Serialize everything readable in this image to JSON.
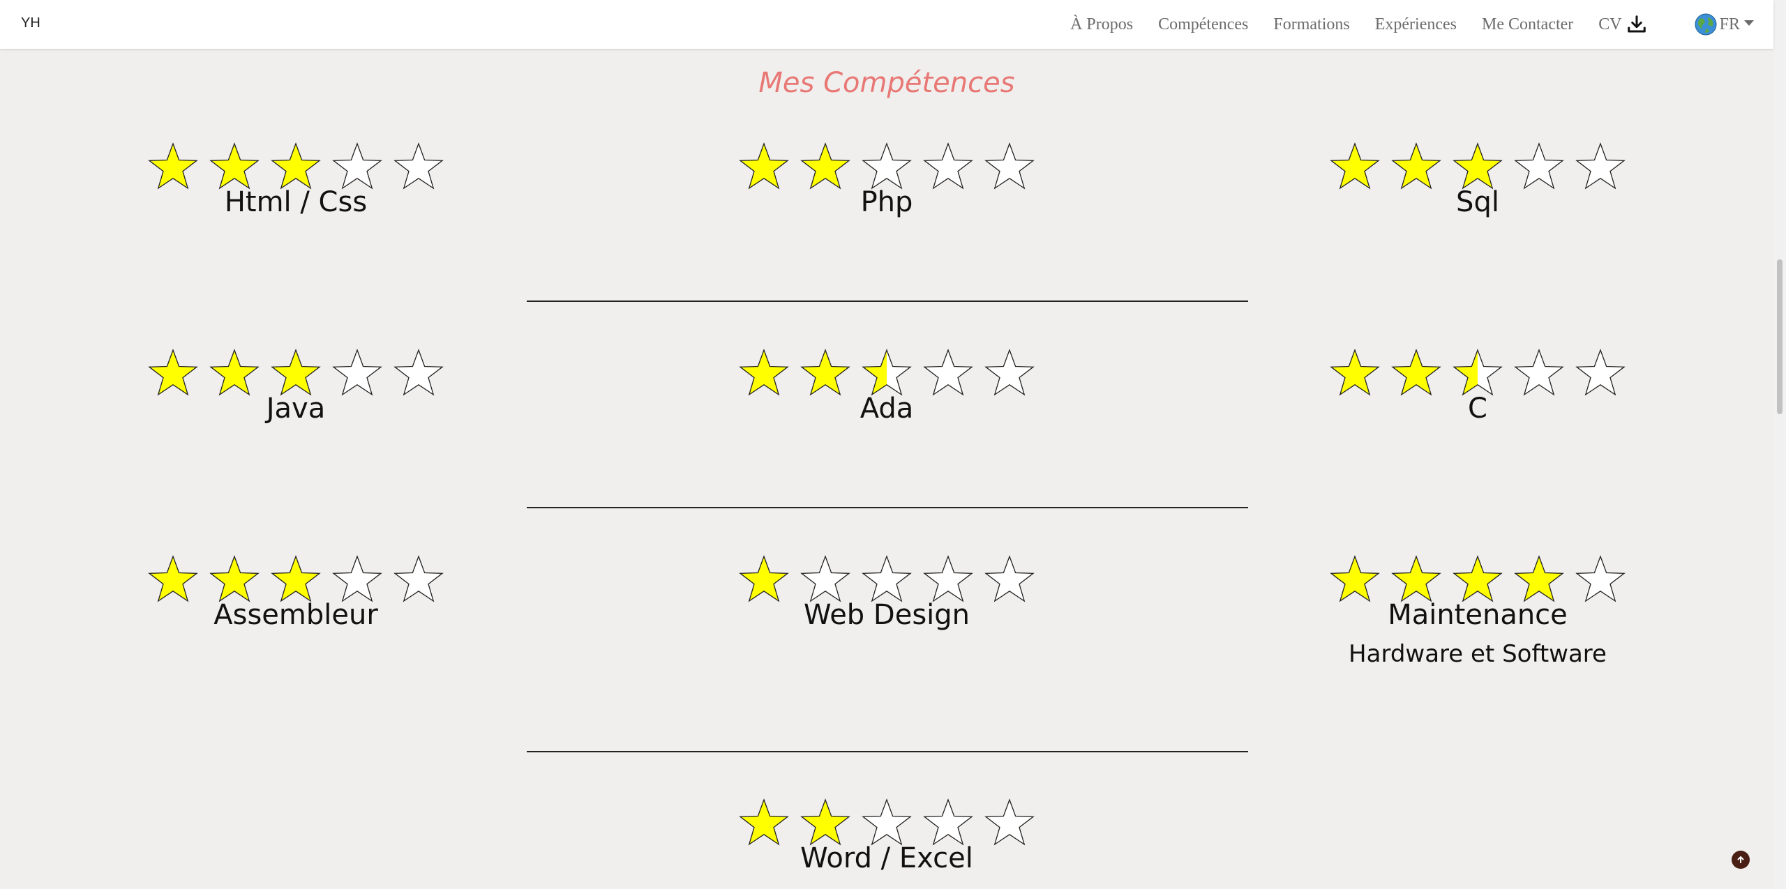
{
  "brand": "YH",
  "nav": {
    "about": "À Propos",
    "skills": "Compétences",
    "education": "Formations",
    "experience": "Expériences",
    "contact": "Me Contacter",
    "cv": "CV",
    "cv_icon": "download-icon",
    "language": "FR",
    "language_icon": "globe-icon"
  },
  "section": {
    "title": "Mes Compétences",
    "title_color": "#e87875"
  },
  "star_colors": {
    "filled": "#ffff00",
    "empty": "#ffffff",
    "outline": "#222222"
  },
  "max_rating": 5,
  "skills": [
    {
      "name": "Html / Css",
      "rating": 3
    },
    {
      "name": "Php",
      "rating": 2
    },
    {
      "name": "Sql",
      "rating": 3
    },
    {
      "name": "Java",
      "rating": 3
    },
    {
      "name": "Ada",
      "rating": 2.5
    },
    {
      "name": "C",
      "rating": 2.5
    },
    {
      "name": "Assembleur",
      "rating": 3
    },
    {
      "name": "Web Design",
      "rating": 1
    },
    {
      "name": "Maintenance",
      "subtitle": "Hardware et Software",
      "rating": 4
    },
    {
      "name": "Word / Excel",
      "rating": 2
    }
  ],
  "scroll_top_icon": "arrow-up-icon"
}
